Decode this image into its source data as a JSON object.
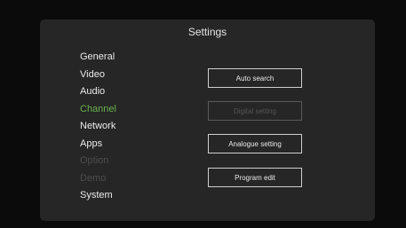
{
  "screen": {
    "title": "Settings"
  },
  "menu": {
    "items": [
      {
        "label": "General",
        "state": "normal"
      },
      {
        "label": "Video",
        "state": "normal"
      },
      {
        "label": "Audio",
        "state": "normal"
      },
      {
        "label": "Channel",
        "state": "active"
      },
      {
        "label": "Network",
        "state": "normal"
      },
      {
        "label": "Apps",
        "state": "normal"
      },
      {
        "label": "Option",
        "state": "disabled"
      },
      {
        "label": "Demo",
        "state": "disabled"
      },
      {
        "label": "System",
        "state": "normal"
      }
    ]
  },
  "actions": {
    "auto_search": "Auto search",
    "digital_setting": "Digital setting",
    "analogue_setting": "Analogue setting",
    "program_edit": "Program edit"
  },
  "colors": {
    "active_menu": "#6ab04c",
    "panel_background": "#262626",
    "screen_background": "#0b0b0b",
    "disabled_text": "#4d4d4d"
  }
}
